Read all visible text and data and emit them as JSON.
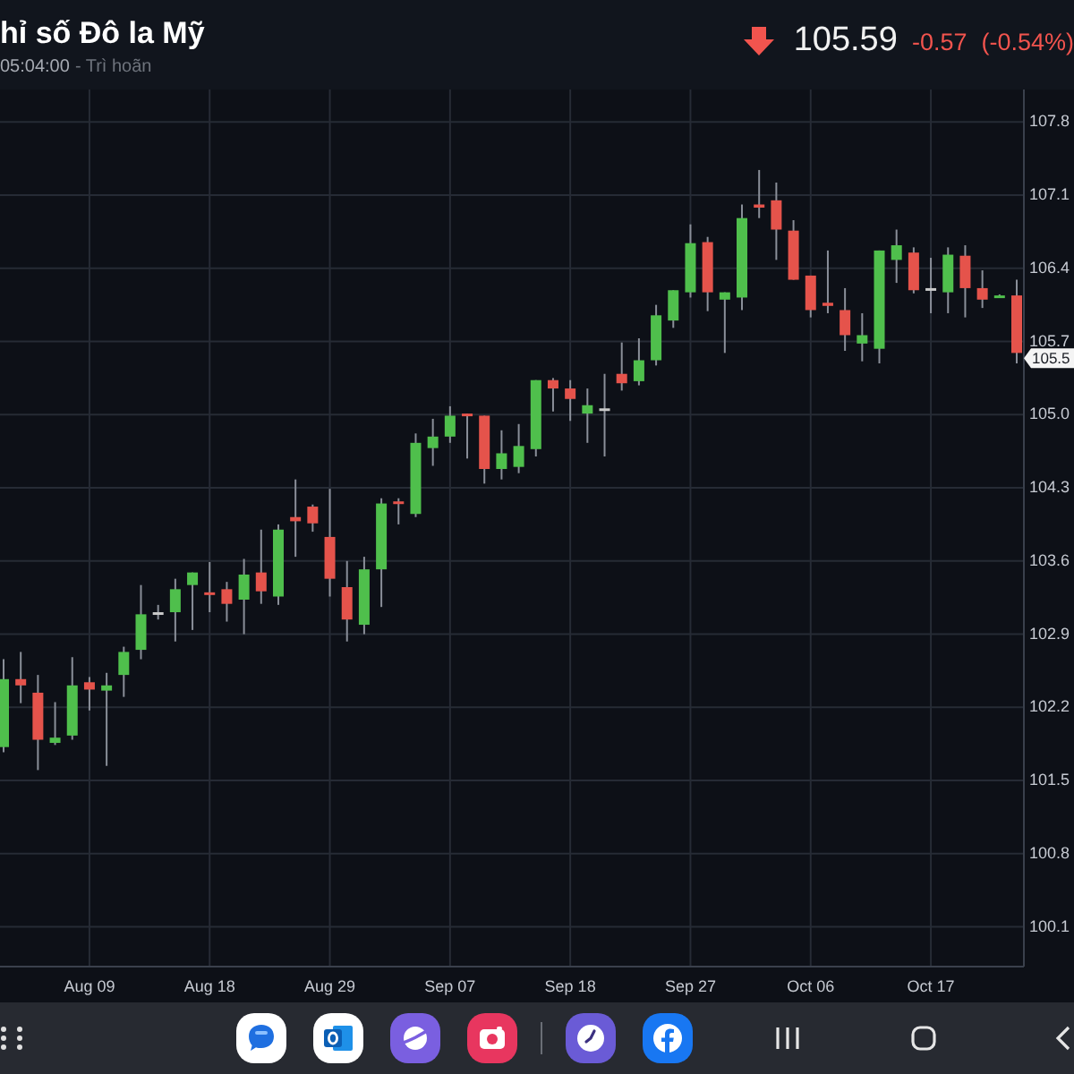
{
  "header": {
    "title": "hỉ số Đô la Mỹ",
    "time": "05:04:00",
    "status": "- Trì hoãn",
    "price": "105.59",
    "change": "-0.57",
    "change_percent": "(-0.54%)"
  },
  "chart": {
    "price_tag": "105.5",
    "chart_data": {
      "type": "candlestick",
      "categories": [
        null,
        null,
        null,
        null,
        null,
        "Aug 09",
        null,
        null,
        null,
        null,
        null,
        null,
        "Aug 18",
        null,
        null,
        null,
        null,
        null,
        null,
        "Aug 29",
        null,
        null,
        null,
        null,
        null,
        null,
        "Sep 07",
        null,
        null,
        null,
        null,
        null,
        null,
        "Sep 18",
        null,
        null,
        null,
        null,
        null,
        null,
        "Sep 27",
        null,
        null,
        null,
        null,
        null,
        null,
        "Oct 06",
        null,
        null,
        null,
        null,
        null,
        null,
        "Oct 17",
        null,
        null,
        null,
        null,
        null
      ],
      "ohlc": [
        [
          101.82,
          102.66,
          101.77,
          102.47
        ],
        [
          102.47,
          102.73,
          102.24,
          102.41
        ],
        [
          102.34,
          102.51,
          101.6,
          101.89
        ],
        [
          101.86,
          102.25,
          101.84,
          101.91
        ],
        [
          101.93,
          102.68,
          101.89,
          102.41
        ],
        [
          102.44,
          102.49,
          102.17,
          102.37
        ],
        [
          102.36,
          102.53,
          101.64,
          102.41
        ],
        [
          102.51,
          102.78,
          102.3,
          102.73
        ],
        [
          102.75,
          103.37,
          102.66,
          103.09
        ],
        [
          103.11,
          103.18,
          103.04,
          103.11
        ],
        [
          103.11,
          103.43,
          102.83,
          103.33
        ],
        [
          103.37,
          103.49,
          102.94,
          103.49
        ],
        [
          103.3,
          103.59,
          103.11,
          103.28
        ],
        [
          103.33,
          103.4,
          103.02,
          103.19
        ],
        [
          103.23,
          103.62,
          102.9,
          103.47
        ],
        [
          103.49,
          103.9,
          103.19,
          103.31
        ],
        [
          103.26,
          103.95,
          103.18,
          103.9
        ],
        [
          104.02,
          104.38,
          103.64,
          103.98
        ],
        [
          104.12,
          104.14,
          103.88,
          103.96
        ],
        [
          103.83,
          104.29,
          103.26,
          103.43
        ],
        [
          103.35,
          103.6,
          102.83,
          103.04
        ],
        [
          102.99,
          103.64,
          102.9,
          103.52
        ],
        [
          103.52,
          104.2,
          103.16,
          104.15
        ],
        [
          104.17,
          104.2,
          103.95,
          104.15
        ],
        [
          104.05,
          104.82,
          104.02,
          104.73
        ],
        [
          104.68,
          104.96,
          104.51,
          104.79
        ],
        [
          104.79,
          105.08,
          104.73,
          104.99
        ],
        [
          105.01,
          105.01,
          104.58,
          105.0
        ],
        [
          104.99,
          104.99,
          104.34,
          104.48
        ],
        [
          104.48,
          104.85,
          104.38,
          104.63
        ],
        [
          104.5,
          104.91,
          104.44,
          104.7
        ],
        [
          104.67,
          105.33,
          104.6,
          105.33
        ],
        [
          105.33,
          105.35,
          105.03,
          105.25
        ],
        [
          105.25,
          105.33,
          104.94,
          105.15
        ],
        [
          105.01,
          105.25,
          104.73,
          105.09
        ],
        [
          105.06,
          105.39,
          104.6,
          105.06
        ],
        [
          105.39,
          105.69,
          105.23,
          105.3
        ],
        [
          105.32,
          105.73,
          105.28,
          105.52
        ],
        [
          105.52,
          106.05,
          105.47,
          105.95
        ],
        [
          105.9,
          106.19,
          105.83,
          106.19
        ],
        [
          106.17,
          106.82,
          106.12,
          106.64
        ],
        [
          106.65,
          106.7,
          105.99,
          106.17
        ],
        [
          106.1,
          106.17,
          105.59,
          106.17
        ],
        [
          106.12,
          107.01,
          106.0,
          106.88
        ],
        [
          107.01,
          107.34,
          106.88,
          106.98
        ],
        [
          107.05,
          107.22,
          106.48,
          106.77
        ],
        [
          106.76,
          106.86,
          106.29,
          106.29
        ],
        [
          106.33,
          106.33,
          105.93,
          106.0
        ],
        [
          106.07,
          106.57,
          105.97,
          106.04
        ],
        [
          106.0,
          106.21,
          105.61,
          105.76
        ],
        [
          105.68,
          105.97,
          105.51,
          105.76
        ],
        [
          105.63,
          106.57,
          105.49,
          106.57
        ],
        [
          106.48,
          106.77,
          106.26,
          106.62
        ],
        [
          106.55,
          106.6,
          106.16,
          106.19
        ],
        [
          106.21,
          106.5,
          105.97,
          106.21
        ],
        [
          106.17,
          106.6,
          105.97,
          106.53
        ],
        [
          106.52,
          106.62,
          105.93,
          106.21
        ],
        [
          106.21,
          106.38,
          106.02,
          106.1
        ],
        [
          106.13,
          106.15,
          106.12,
          106.14
        ],
        [
          106.14,
          106.29,
          105.49,
          105.59
        ]
      ],
      "grid": true,
      "ylim": [
        99.72,
        108.11
      ],
      "yticks": [
        {
          "value": 107.8,
          "label": "107.8"
        },
        {
          "value": 107.1,
          "label": "107.1"
        },
        {
          "value": 106.4,
          "label": "106.4"
        },
        {
          "value": 105.7,
          "label": "105.7"
        },
        {
          "value": 105.0,
          "label": "105.0"
        },
        {
          "value": 104.3,
          "label": "104.3"
        },
        {
          "value": 103.6,
          "label": "103.6"
        },
        {
          "value": 102.9,
          "label": "102.9"
        },
        {
          "value": 102.2,
          "label": "102.2"
        },
        {
          "value": 101.5,
          "label": "101.5"
        },
        {
          "value": 100.8,
          "label": "100.8"
        },
        {
          "value": 100.1,
          "label": "100.1"
        }
      ]
    }
  },
  "taskbar": {
    "apps": [
      {
        "kind": "messages"
      },
      {
        "kind": "outlook"
      },
      {
        "kind": "internet"
      },
      {
        "kind": "camera"
      }
    ],
    "recent_apps": [
      {
        "kind": "clock"
      },
      {
        "kind": "facebook"
      }
    ],
    "nav": [
      {
        "kind": "recents"
      },
      {
        "kind": "home"
      },
      {
        "kind": "back"
      }
    ]
  }
}
